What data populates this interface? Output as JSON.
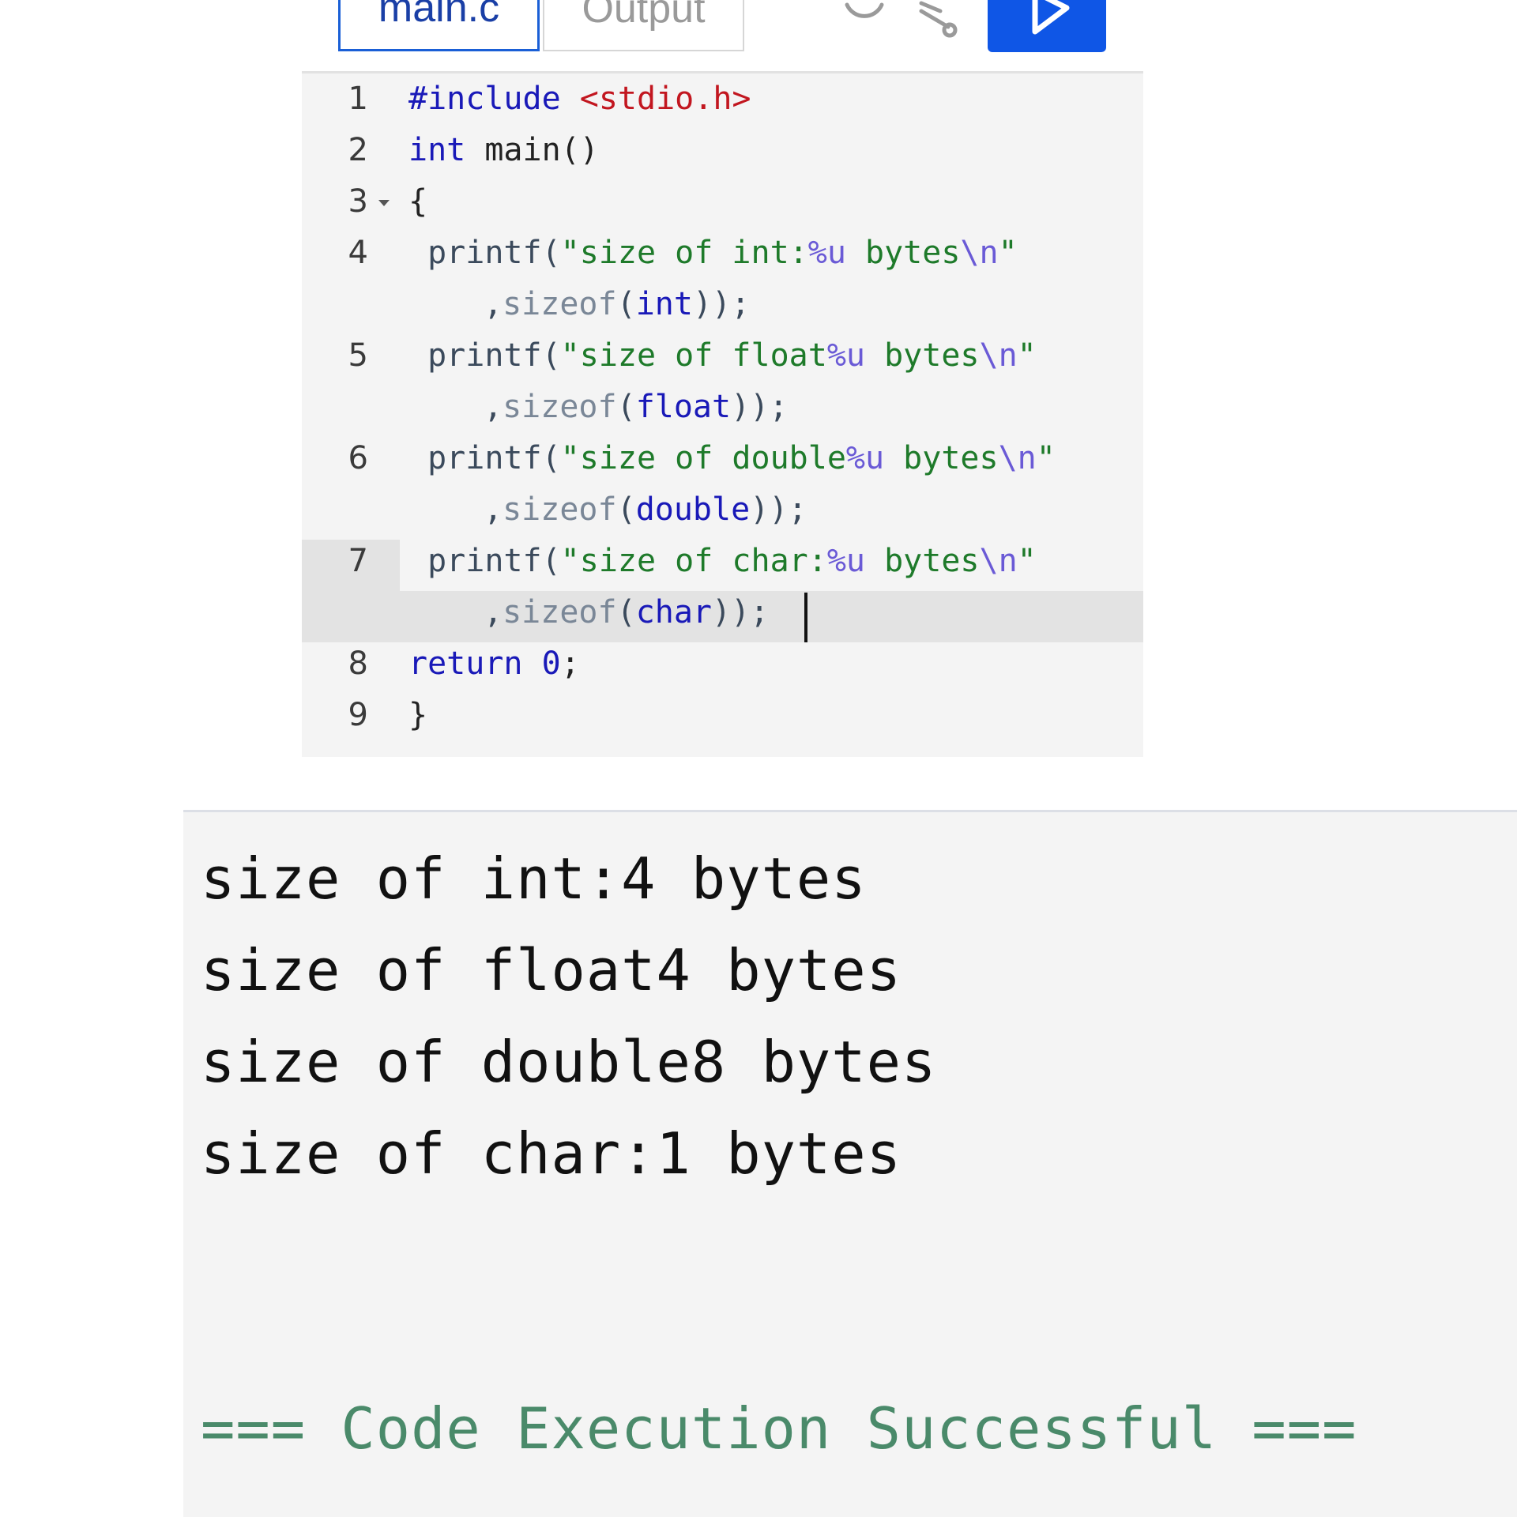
{
  "tabs": {
    "file": "main.c",
    "output": "Output"
  },
  "toolbar": {
    "theme_icon": "moon-icon",
    "share_icon": "share-icon",
    "run_icon": "play-icon",
    "colors": {
      "run_button": "#0f56e6",
      "active_tab_border": "#1a5fd6"
    }
  },
  "editor": {
    "line_numbers": [
      "1",
      "2",
      "3",
      "4",
      "5",
      "6",
      "7",
      "8",
      "9"
    ],
    "lines": {
      "l1": {
        "a": "#include",
        "b": " ",
        "c": "<stdio.h>"
      },
      "l2": {
        "a": "int",
        "b": " main()"
      },
      "l3": {
        "a": "{"
      },
      "l4": {
        "a": " printf",
        "b": "(",
        "c": "\"size of int:",
        "d": "%u",
        "e": " bytes",
        "f": "\\n",
        "g": "\"",
        "cont_a": ",",
        "cont_b": "sizeof",
        "cont_c": "(",
        "cont_d": "int",
        "cont_e": "));"
      },
      "l5": {
        "a": " printf",
        "b": "(",
        "c": "\"size of float",
        "d": "%u",
        "e": " bytes",
        "f": "\\n",
        "g": "\"",
        "cont_a": ",",
        "cont_b": "sizeof",
        "cont_c": "(",
        "cont_d": "float",
        "cont_e": "));"
      },
      "l6": {
        "a": " printf",
        "b": "(",
        "c": "\"size of double",
        "d": "%u",
        "e": " bytes",
        "f": "\\n",
        "g": "\"",
        "cont_a": ",",
        "cont_b": "sizeof",
        "cont_c": "(",
        "cont_d": "double",
        "cont_e": "));"
      },
      "l7": {
        "a": " printf",
        "b": "(",
        "c": "\"size of char:",
        "d": "%u",
        "e": " bytes",
        "f": "\\n",
        "g": "\"",
        "cont_a": ",",
        "cont_b": "sizeof",
        "cont_c": "(",
        "cont_d": "char",
        "cont_e": "));"
      },
      "l8": {
        "a": "return",
        "b": " ",
        "c": "0",
        "d": ";"
      },
      "l9": {
        "a": "}"
      }
    }
  },
  "console": {
    "output_lines": [
      "size of int:4 bytes",
      "size of float4 bytes",
      "size of double8 bytes",
      "size of char:1 bytes"
    ],
    "status": "=== Code Execution Successful ==="
  }
}
